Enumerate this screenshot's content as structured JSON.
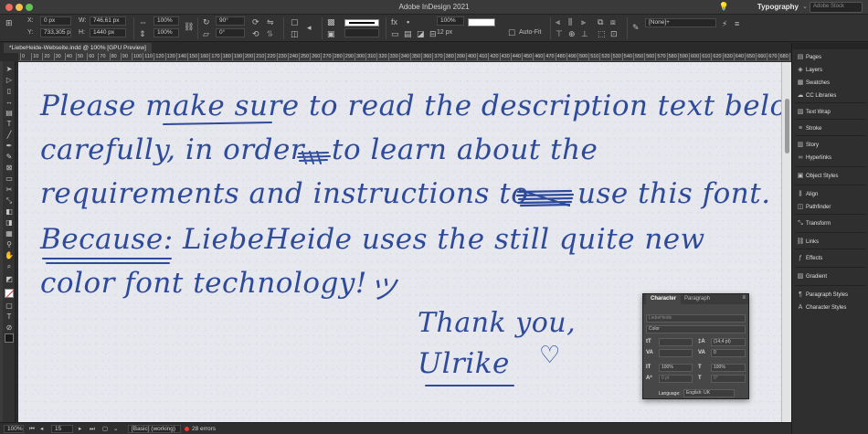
{
  "window": {
    "title": "Adobe InDesign 2021",
    "workspace": "Typography",
    "search_placeholder": "Adobe Stock"
  },
  "control_panel": {
    "x_label": "X:",
    "x_value": "0 px",
    "y_label": "Y:",
    "y_value": "733,305 px",
    "w_label": "W:",
    "w_value": "746,61 px",
    "h_label": "H:",
    "h_value": "1440 px",
    "scale_x": "100%",
    "scale_y": "100%",
    "rotation": "90°",
    "shear": "0°",
    "stroke_weight": "12 px",
    "opacity": "100%",
    "autofit_label": "Auto-Fit",
    "object_style": "[None]+"
  },
  "document": {
    "tab_label": "*LiebeHeide-Webseite.indd @ 100% [GPU Preview]"
  },
  "ruler": {
    "ticks": [
      "0",
      "10",
      "20",
      "30",
      "40",
      "50",
      "60",
      "70",
      "80",
      "90",
      "100",
      "110",
      "120",
      "130",
      "140",
      "150",
      "160",
      "170",
      "180",
      "190",
      "200",
      "210",
      "220",
      "230",
      "240",
      "250",
      "260",
      "270",
      "280",
      "290",
      "300",
      "310",
      "320",
      "330",
      "340",
      "350",
      "360",
      "370",
      "380",
      "390",
      "400",
      "410",
      "420",
      "430",
      "440",
      "450",
      "460",
      "470",
      "480",
      "490",
      "500",
      "510",
      "520",
      "530",
      "540",
      "550",
      "560",
      "570",
      "580",
      "590",
      "600",
      "610",
      "620",
      "630",
      "640",
      "650",
      "660",
      "670",
      "680",
      "690"
    ]
  },
  "canvas_text": {
    "line1": "Please make sure to read the description text below",
    "line2a": "carefully, in order",
    "line2b": "to learn about the",
    "line3a": "requirements and instructions to",
    "line3b": "use this font.",
    "line4": "Because: LiebeHeide uses the still quite new",
    "line5": "color font technology!",
    "smiley": "ツ",
    "thanks": "Thank you,",
    "signature": "Ulrike",
    "heart": "♡"
  },
  "status_bar": {
    "zoom": "100%",
    "page": "15",
    "preflight_profile": "[Basic] (working)",
    "errors": "28 errors"
  },
  "dock": {
    "items": [
      {
        "label": "Pages",
        "icon": "pages-icon"
      },
      {
        "label": "Layers",
        "icon": "layers-icon"
      },
      {
        "label": "Swatches",
        "icon": "swatches-icon"
      },
      {
        "label": "CC Libraries",
        "icon": "cc-libraries-icon"
      },
      {
        "label": "Text Wrap",
        "icon": "text-wrap-icon"
      },
      {
        "label": "Stroke",
        "icon": "stroke-icon"
      },
      {
        "label": "Story",
        "icon": "story-icon"
      },
      {
        "label": "Hyperlinks",
        "icon": "hyperlinks-icon"
      },
      {
        "label": "Object Styles",
        "icon": "object-styles-icon"
      },
      {
        "label": "Align",
        "icon": "align-icon"
      },
      {
        "label": "Pathfinder",
        "icon": "pathfinder-icon"
      },
      {
        "label": "Transform",
        "icon": "transform-icon"
      },
      {
        "label": "Links",
        "icon": "links-icon"
      },
      {
        "label": "Effects",
        "icon": "effects-icon"
      },
      {
        "label": "Gradient",
        "icon": "gradient-icon"
      },
      {
        "label": "Paragraph Styles",
        "icon": "paragraph-styles-icon"
      },
      {
        "label": "Character Styles",
        "icon": "character-styles-icon"
      }
    ]
  },
  "character_panel": {
    "tab_character": "Character",
    "tab_paragraph": "Paragraph",
    "font_family": "LiebeHeide",
    "font_style": "Color",
    "leading": "(14,4 pt)",
    "tracking": "0",
    "vertical_scale": "100%",
    "horizontal_scale": "100%",
    "baseline_shift": "0 pt",
    "skew": "0°",
    "language_label": "Language:",
    "language_value": "English: UK"
  },
  "colors": {
    "ink": "#2e4a9b",
    "paper": "#e7e8ee",
    "ui_dark": "#2f2f2f",
    "error_red": "#e53b30"
  }
}
